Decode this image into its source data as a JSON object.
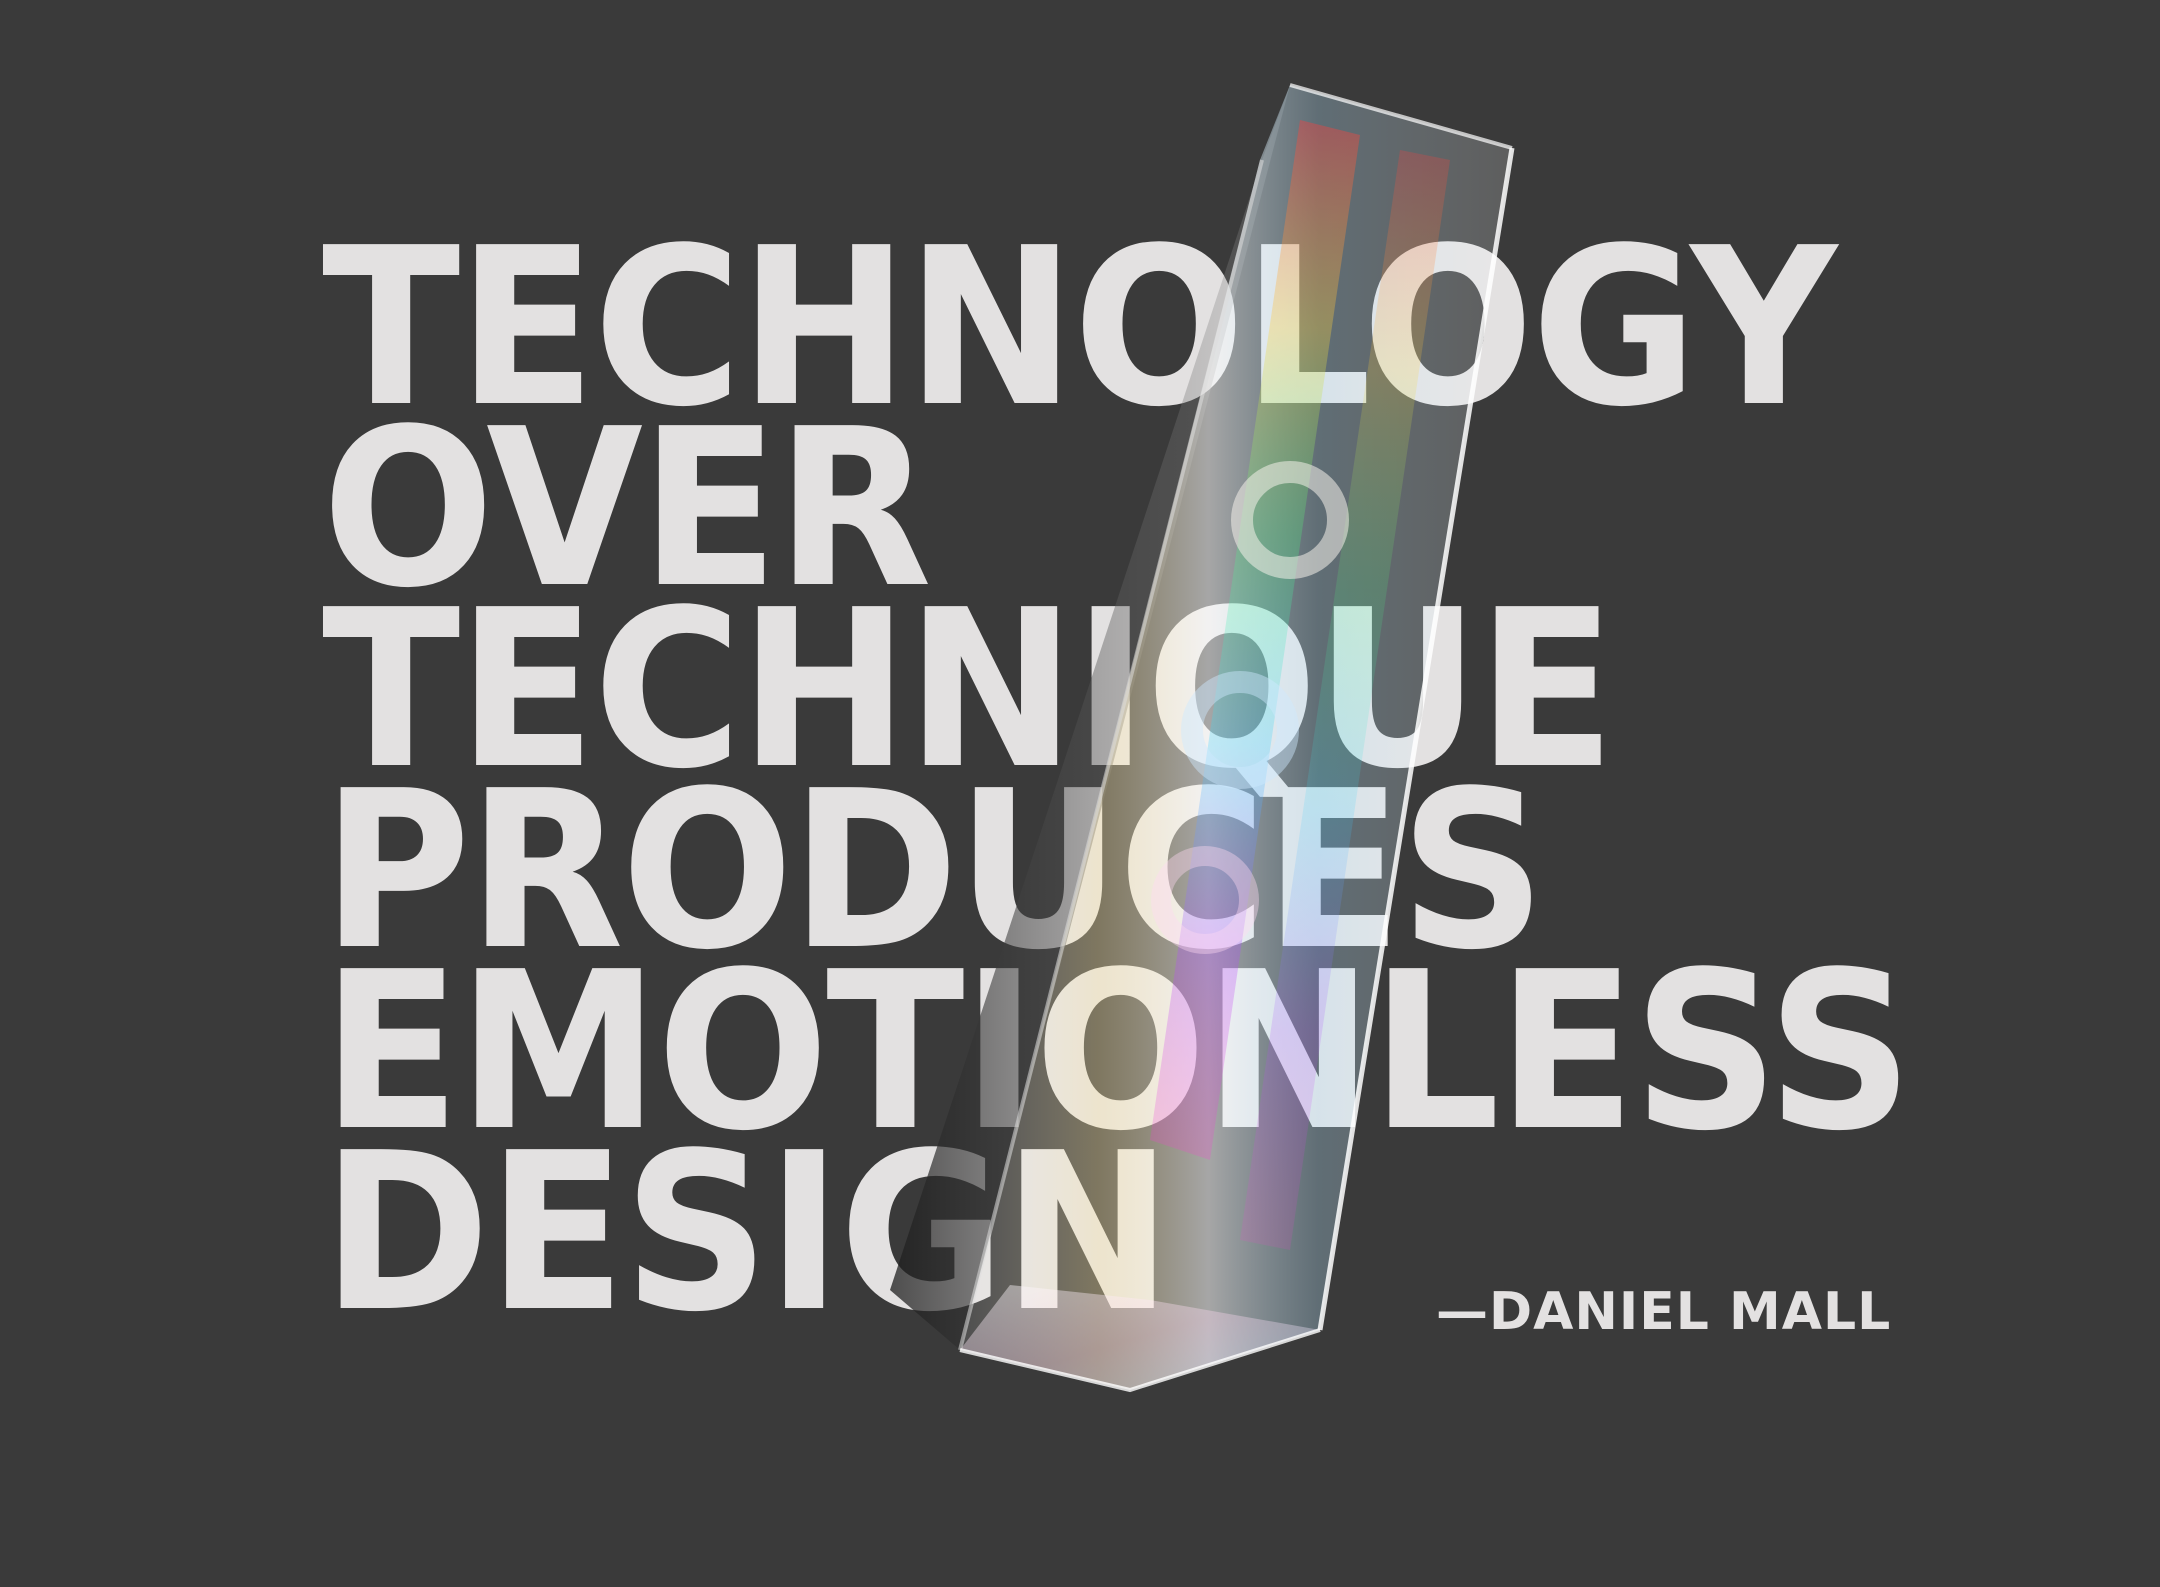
{
  "quote": {
    "lines": [
      "TECHNOLOGY",
      "OVER",
      "TECHNIQUE",
      "PRODUCES",
      "EMOTIONLESS",
      "DESIGN"
    ],
    "attribution": "—DANIEL MALL"
  },
  "colors": {
    "background": "#3a3a3a",
    "text": "#e3e1e1",
    "prism_tint": "#f4f1ea"
  },
  "decoration": {
    "object": "refracting-glass-prism-icon"
  }
}
